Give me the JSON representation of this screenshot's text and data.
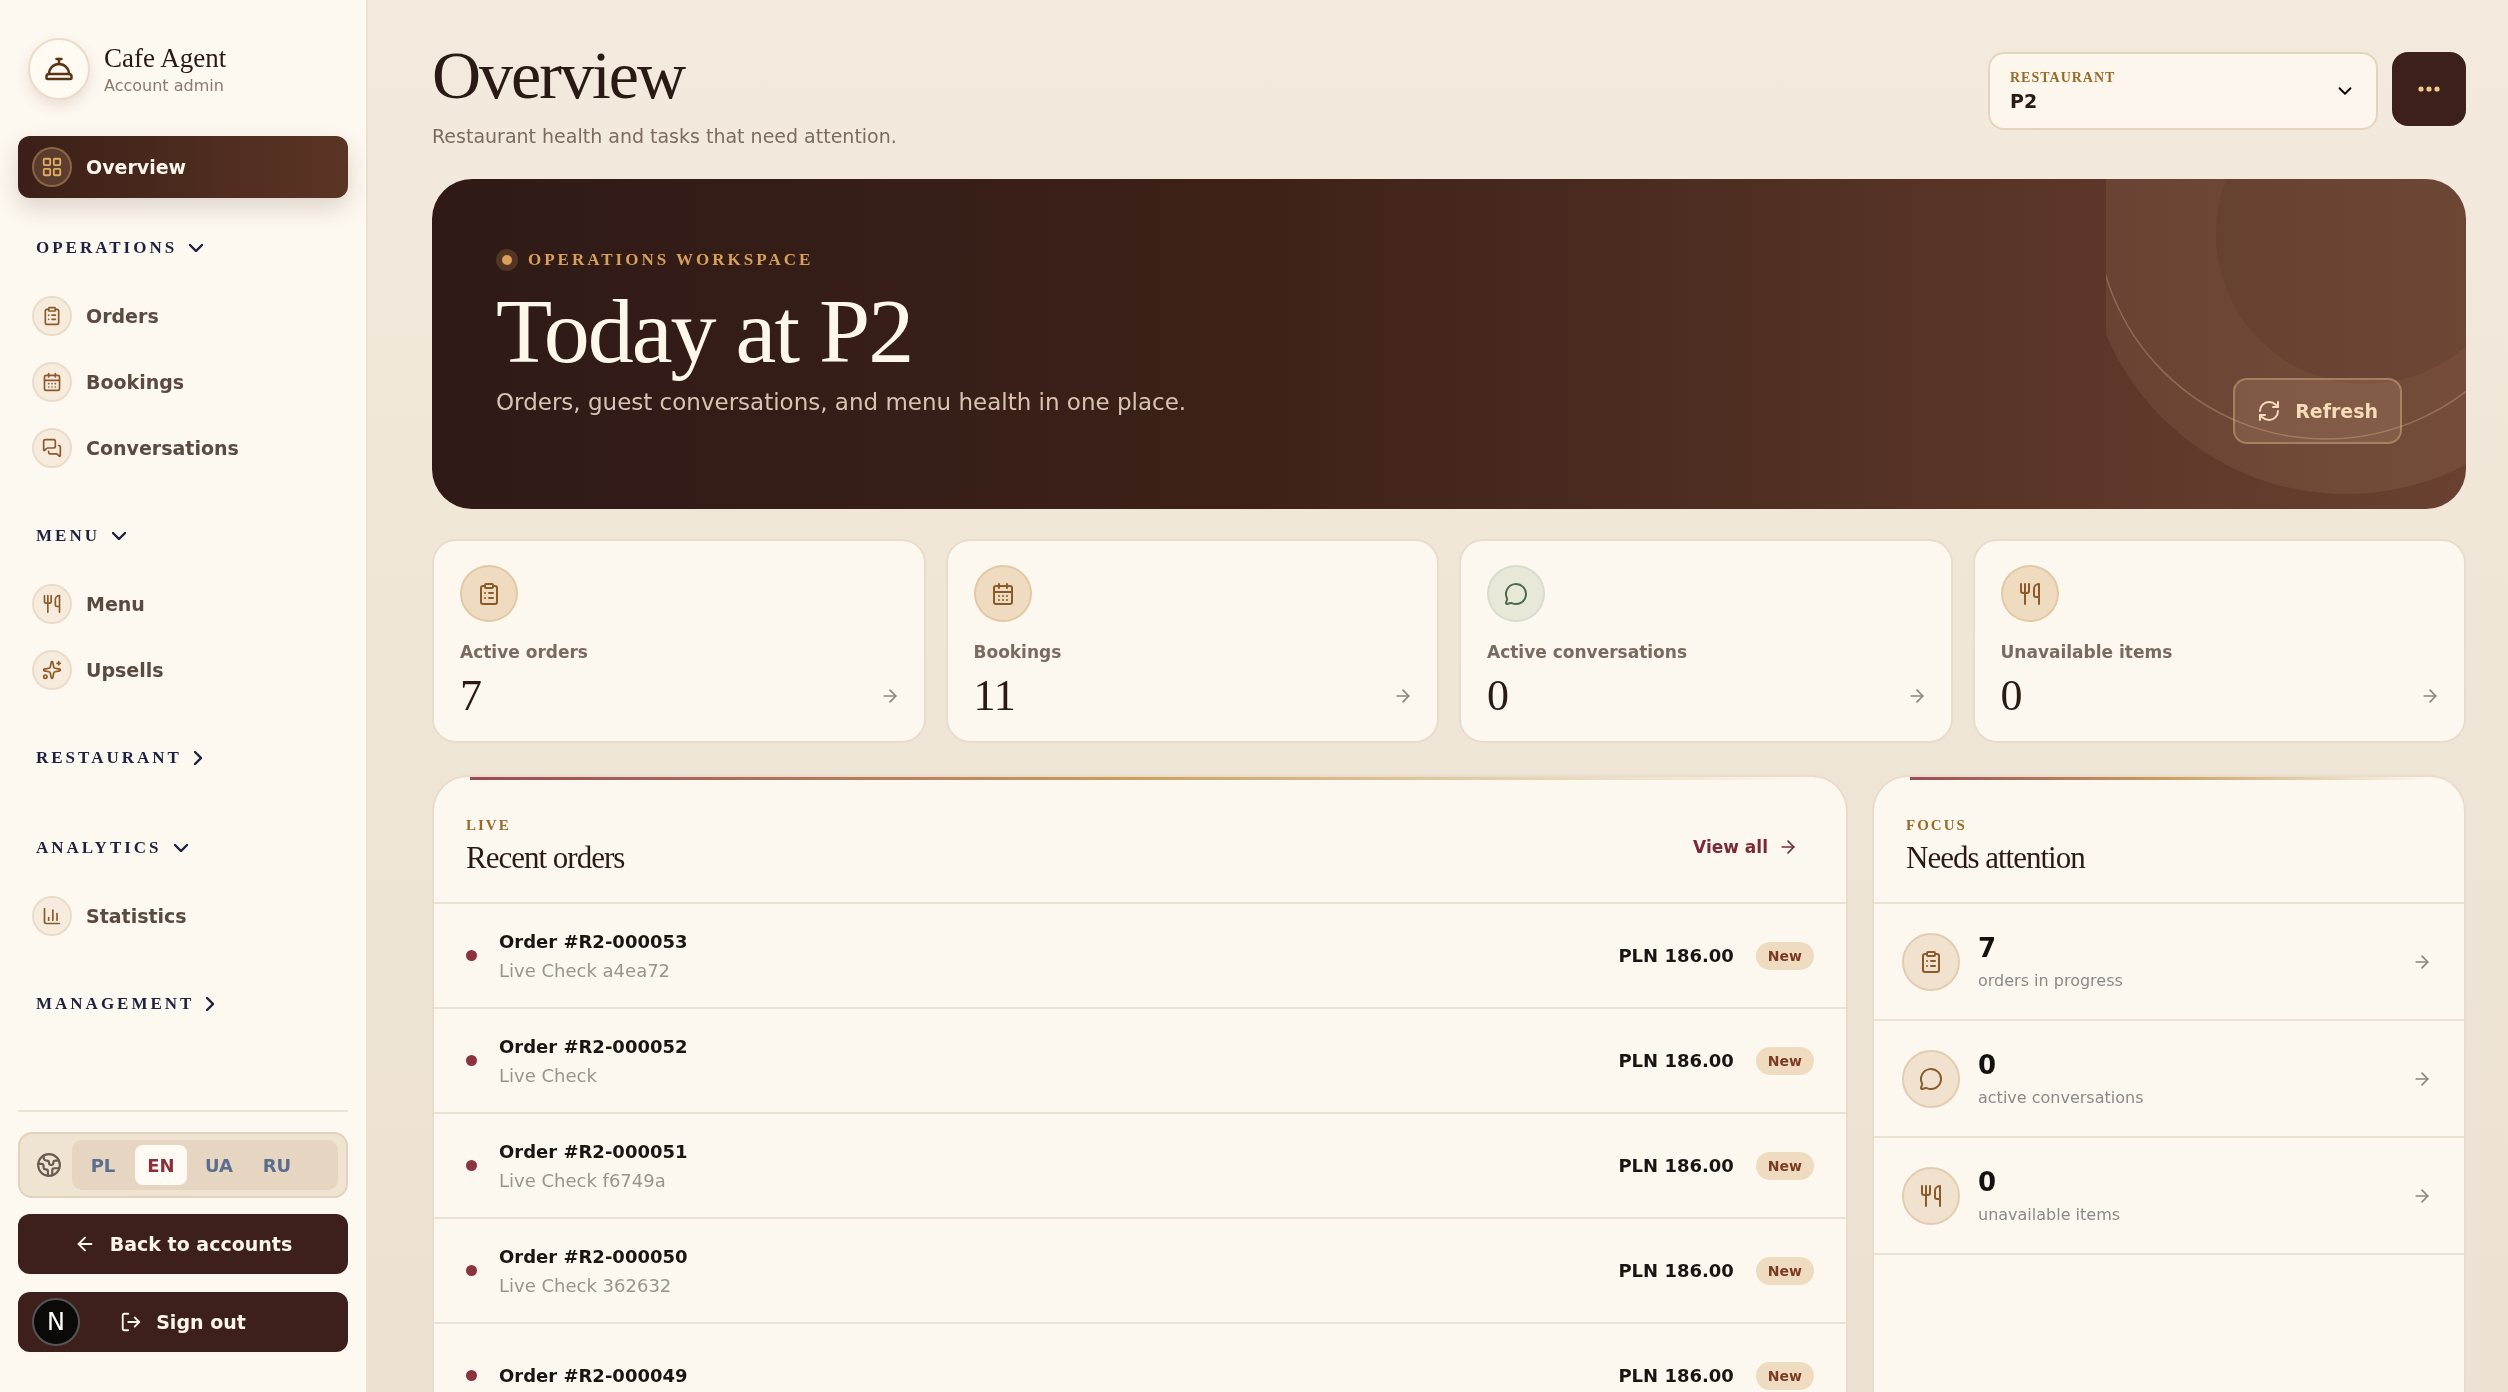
{
  "brand": {
    "name": "Cafe Agent",
    "subtitle": "Account admin"
  },
  "nav_top": [
    {
      "label": "Overview",
      "selected": true
    }
  ],
  "nav_sections": [
    {
      "label": "OPERATIONS",
      "expanded": true,
      "items": [
        {
          "label": "Orders",
          "selected": false
        },
        {
          "label": "Bookings",
          "selected": false
        },
        {
          "label": "Conversations",
          "selected": false
        }
      ]
    },
    {
      "label": "MENU",
      "expanded": true,
      "items": [
        {
          "label": "Menu",
          "selected": false
        },
        {
          "label": "Upsells",
          "selected": false
        }
      ]
    },
    {
      "label": "RESTAURANT",
      "expanded": false
    },
    {
      "label": "ANALYTICS",
      "expanded": true,
      "items": [
        {
          "label": "Statistics",
          "selected": false
        }
      ]
    },
    {
      "label": "MANAGEMENT",
      "expanded": false
    }
  ],
  "languages": [
    {
      "label": "PL",
      "selected": false
    },
    {
      "label": "EN",
      "selected": true
    },
    {
      "label": "UA",
      "selected": false
    },
    {
      "label": "RU",
      "selected": false
    }
  ],
  "back_button": "Back to accounts",
  "sign_out_button": "Sign out",
  "dev_badge": "N",
  "header": {
    "title": "Overview",
    "subtitle": "Restaurant health and tasks that need attention.",
    "restaurant_select": {
      "label": "RESTAURANT",
      "value": "P2"
    }
  },
  "hero": {
    "eyebrow": "OPERATIONS WORKSPACE",
    "title": "Today at P2",
    "subtitle": "Orders, guest conversations, and menu health in one place.",
    "refresh": "Refresh"
  },
  "stats": [
    {
      "label": "Active orders",
      "value": "7"
    },
    {
      "label": "Bookings",
      "value": "11"
    },
    {
      "label": "Active conversations",
      "value": "0"
    },
    {
      "label": "Unavailable items",
      "value": "0"
    }
  ],
  "recent_orders": {
    "eyebrow": "LIVE",
    "title": "Recent orders",
    "view_all": "View all",
    "orders": [
      {
        "title": "Order #R2-000053",
        "subtitle": "Live Check a4ea72",
        "amount": "PLN 186.00",
        "status": "New"
      },
      {
        "title": "Order #R2-000052",
        "subtitle": "Live Check",
        "amount": "PLN 186.00",
        "status": "New"
      },
      {
        "title": "Order #R2-000051",
        "subtitle": "Live Check f6749a",
        "amount": "PLN 186.00",
        "status": "New"
      },
      {
        "title": "Order #R2-000050",
        "subtitle": "Live Check 362632",
        "amount": "PLN 186.00",
        "status": "New"
      },
      {
        "title": "Order #R2-000049",
        "amount": "PLN 186.00",
        "status": "New"
      }
    ]
  },
  "attention": {
    "eyebrow": "FOCUS",
    "title": "Needs attention",
    "items": [
      {
        "value": "7",
        "label": "orders in progress"
      },
      {
        "value": "0",
        "label": "active conversations"
      },
      {
        "value": "0",
        "label": "unavailable items"
      }
    ]
  }
}
